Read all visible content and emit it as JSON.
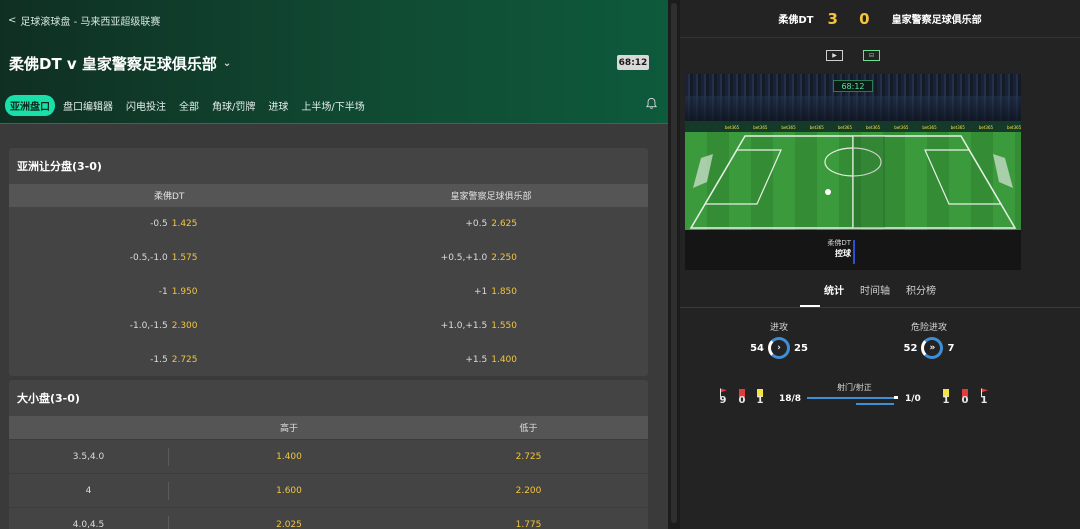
{
  "breadcrumb": {
    "back": "<",
    "path": "足球滚球盘 - 马来西亚超级联赛"
  },
  "match": {
    "title": "柔佛DT v 皇家警察足球俱乐部",
    "clock": "68:12"
  },
  "tabs": [
    "亚洲盘口",
    "盘口编辑器",
    "闪电投注",
    "全部",
    "角球/罚牌",
    "进球",
    "上半场/下半场"
  ],
  "asian_handicap": {
    "title": "亚洲让分盘(3-0)",
    "home": "柔佛DT",
    "away": "皇家警察足球俱乐部",
    "rows": [
      {
        "home_line": "-0.5",
        "home_odds": "1.425",
        "away_line": "+0.5",
        "away_odds": "2.625"
      },
      {
        "home_line": "-0.5,-1.0",
        "home_odds": "1.575",
        "away_line": "+0.5,+1.0",
        "away_odds": "2.250"
      },
      {
        "home_line": "-1",
        "home_odds": "1.950",
        "away_line": "+1",
        "away_odds": "1.850"
      },
      {
        "home_line": "-1.0,-1.5",
        "home_odds": "2.300",
        "away_line": "+1.0,+1.5",
        "away_odds": "1.550"
      },
      {
        "home_line": "-1.5",
        "home_odds": "2.725",
        "away_line": "+1.5",
        "away_odds": "1.400"
      }
    ]
  },
  "over_under": {
    "title": "大小盘(3-0)",
    "over": "高于",
    "under": "低于",
    "rows": [
      {
        "line": "3.5,4.0",
        "over": "1.400",
        "under": "2.725"
      },
      {
        "line": "4",
        "over": "1.600",
        "under": "2.200"
      },
      {
        "line": "4.0,4.5",
        "over": "2.025",
        "under": "1.775"
      }
    ]
  },
  "scoreboard": {
    "home": "柔佛DT",
    "score": "3 0",
    "away": "皇家警察足球俱乐部"
  },
  "pitch": {
    "clock": "68:12",
    "ad": "bet365",
    "possession_team": "柔佛DT",
    "possession_label": "控球"
  },
  "stat_tabs": [
    "统计",
    "时间轴",
    "积分榜"
  ],
  "stats": {
    "attacks": {
      "label": "进攻",
      "home": "54",
      "away": "25"
    },
    "dangerous": {
      "label": "危险进攻",
      "home": "52",
      "away": "7"
    },
    "cards_home": {
      "corners": "9",
      "red": "0",
      "yellow": "1"
    },
    "cards_away": {
      "yellow": "1",
      "red": "0",
      "corners": "1"
    },
    "shots": {
      "label": "射门/射正",
      "home": "18/8",
      "away": "1/0"
    }
  },
  "colors": {
    "accent": "#18e0a8",
    "odds": "#f2c53d",
    "blue": "#3f8fd6"
  }
}
